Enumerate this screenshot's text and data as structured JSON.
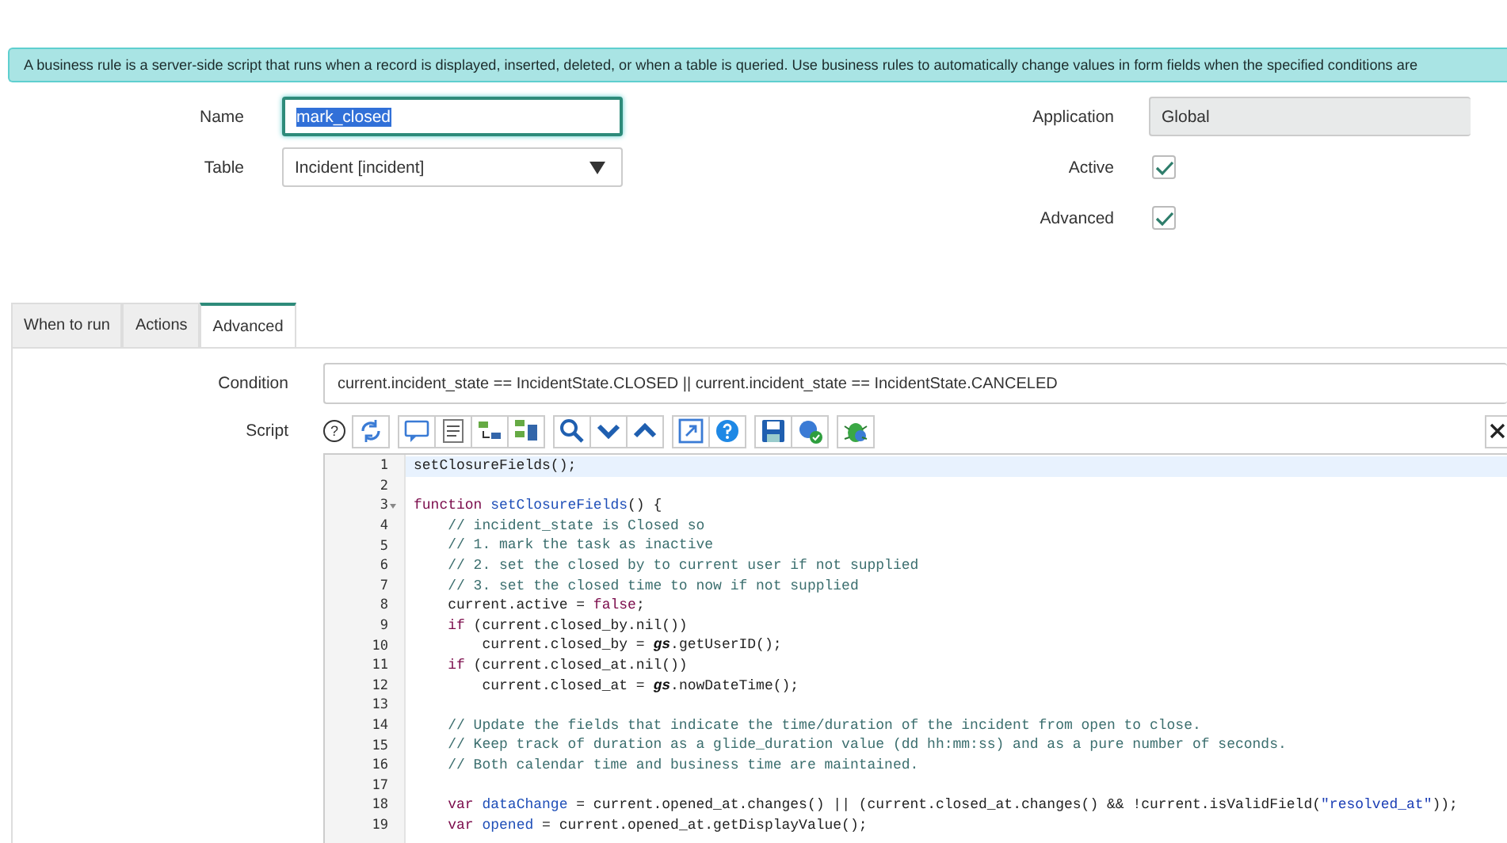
{
  "banner": {
    "text": "A business rule is a server-side script that runs when a record is displayed, inserted, deleted, or when a table is queried. Use business rules to automatically change values in form fields when the specified conditions are"
  },
  "form": {
    "name": {
      "label": "Name",
      "value": "mark_closed"
    },
    "table": {
      "label": "Table",
      "value": "Incident [incident]"
    },
    "application": {
      "label": "Application",
      "value": "Global"
    },
    "checks": [
      {
        "label": "Active",
        "checked": true
      },
      {
        "label": "Advanced",
        "checked": true
      }
    ]
  },
  "tabs": [
    {
      "label": "When to run",
      "selected": false
    },
    {
      "label": "Actions",
      "selected": false
    },
    {
      "label": "Advanced",
      "selected": true
    }
  ],
  "condition": {
    "label": "Condition",
    "value": "current.incident_state == IncidentState.CLOSED || current.incident_state == IncidentState.CANCELED"
  },
  "script": {
    "label": "Script",
    "help": "?",
    "lines": [
      {
        "num": "1",
        "current": true,
        "fold": false,
        "parts": [
          {
            "kind": "plain",
            "text": "setClosureFields();"
          }
        ]
      },
      {
        "num": "2",
        "current": false,
        "fold": false
      },
      {
        "num": "3",
        "current": false,
        "fold": true,
        "parts": [
          {
            "kind": "keyword",
            "text": "function "
          },
          {
            "kind": "name",
            "text": "setClosureFields"
          },
          {
            "kind": "plain",
            "text": "() {"
          }
        ]
      },
      {
        "num": "4",
        "current": false,
        "fold": false,
        "parts": [
          {
            "kind": "comment",
            "text": "    // incident_state is Closed so"
          }
        ]
      },
      {
        "num": "5",
        "current": false,
        "fold": false,
        "parts": [
          {
            "kind": "comment",
            "text": "    // 1. mark the task as inactive"
          }
        ]
      },
      {
        "num": "6",
        "current": false,
        "fold": false,
        "parts": [
          {
            "kind": "comment",
            "text": "    // 2. set the closed by to current user if not supplied"
          }
        ]
      },
      {
        "num": "7",
        "current": false,
        "fold": false,
        "parts": [
          {
            "kind": "comment",
            "text": "    // 3. set the closed time to now if not supplied"
          }
        ]
      },
      {
        "num": "8",
        "current": false,
        "fold": false,
        "parts": [
          {
            "kind": "plain",
            "text": "    current.active = "
          },
          {
            "kind": "keyword",
            "text": "false"
          },
          {
            "kind": "plain",
            "text": ";"
          }
        ]
      },
      {
        "num": "9",
        "current": false,
        "fold": false,
        "parts": [
          {
            "kind": "keyword",
            "text": "    if"
          },
          {
            "kind": "plain",
            "text": " (current.closed_by.nil())"
          }
        ]
      },
      {
        "num": "10",
        "current": false,
        "fold": false,
        "parts": [
          {
            "kind": "plain",
            "text": "        current.closed_by = "
          },
          {
            "kind": "global",
            "text": "gs"
          },
          {
            "kind": "plain",
            "text": ".getUserID();"
          }
        ]
      },
      {
        "num": "11",
        "current": false,
        "fold": false,
        "parts": [
          {
            "kind": "keyword",
            "text": "    if"
          },
          {
            "kind": "plain",
            "text": " (current.closed_at.nil())"
          }
        ]
      },
      {
        "num": "12",
        "current": false,
        "fold": false,
        "parts": [
          {
            "kind": "plain",
            "text": "        current.closed_at = "
          },
          {
            "kind": "global",
            "text": "gs"
          },
          {
            "kind": "plain",
            "text": ".nowDateTime();"
          }
        ]
      },
      {
        "num": "13",
        "current": false,
        "fold": false
      },
      {
        "num": "14",
        "current": false,
        "fold": false,
        "parts": [
          {
            "kind": "comment",
            "text": "    // Update the fields that indicate the time/duration of the incident from open to close."
          }
        ]
      },
      {
        "num": "15",
        "current": false,
        "fold": false,
        "parts": [
          {
            "kind": "comment",
            "text": "    // Keep track of duration as a glide_duration value (dd hh:mm:ss) and as a pure number of seconds."
          }
        ]
      },
      {
        "num": "16",
        "current": false,
        "fold": false,
        "parts": [
          {
            "kind": "comment",
            "text": "    // Both calendar time and business time are maintained."
          }
        ]
      },
      {
        "num": "17",
        "current": false,
        "fold": false
      },
      {
        "num": "18",
        "current": false,
        "fold": false,
        "parts": [
          {
            "kind": "keyword",
            "text": "    var "
          },
          {
            "kind": "name",
            "text": "dataChange"
          },
          {
            "kind": "plain",
            "text": " = current.opened_at.changes() || (current.closed_at.changes() && !current.isValidField("
          },
          {
            "kind": "string",
            "text": "\"resolved_at\""
          },
          {
            "kind": "plain",
            "text": "));"
          }
        ]
      },
      {
        "num": "19",
        "current": false,
        "fold": false,
        "parts": [
          {
            "kind": "keyword",
            "text": "    var "
          },
          {
            "kind": "name",
            "text": "opened"
          },
          {
            "kind": "plain",
            "text": " = current.opened_at.getDisplayValue();"
          }
        ]
      }
    ]
  }
}
